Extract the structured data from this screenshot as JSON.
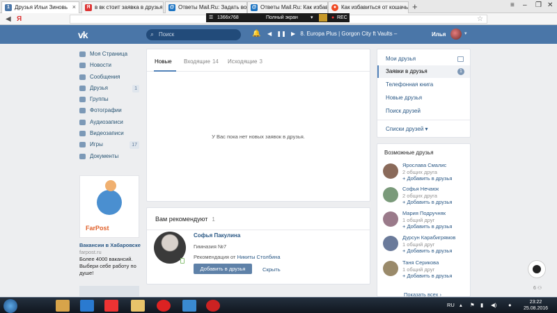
{
  "browser": {
    "tabs": [
      {
        "title": "Друзья Ильи Зиновь",
        "fav": "1",
        "color": "#4a76a8"
      },
      {
        "title": "в вк стоит заявка в друзья",
        "fav": "Я",
        "color": "#d33"
      },
      {
        "title": "Ответы Mail.Ru: Задать воп",
        "fav": "@",
        "color": "#1a73c2"
      },
      {
        "title": "Ответы Mail.Ru: Как избав",
        "fav": "@",
        "color": "#1a73c2"
      },
      {
        "title": "Как избавиться от кошачь",
        "fav": "●",
        "color": "#f04a24"
      }
    ],
    "address_prefix": "Я",
    "capture": {
      "resolution": "1366x768",
      "mode": "Полный экран",
      "rec": "REC"
    }
  },
  "header": {
    "search_placeholder": "Поиск",
    "player": "8. Europa Plus | Gorgon City ft Vaults –",
    "username": "Илья"
  },
  "leftnav": [
    {
      "label": "Моя Страница",
      "count": ""
    },
    {
      "label": "Новости",
      "count": ""
    },
    {
      "label": "Сообщения",
      "count": ""
    },
    {
      "label": "Друзья",
      "count": "1"
    },
    {
      "label": "Группы",
      "count": ""
    },
    {
      "label": "Фотографии",
      "count": ""
    },
    {
      "label": "Аудиозаписи",
      "count": ""
    },
    {
      "label": "Видеозаписи",
      "count": ""
    },
    {
      "label": "Игры",
      "count": "17"
    },
    {
      "label": "Документы",
      "count": ""
    }
  ],
  "ad": {
    "logo": "FarPost",
    "title": "Вакансии в Хабаровске",
    "site": "farpost.ru",
    "text": "Более 4000 вакансий. Выбери себе работу по душе!"
  },
  "requests": {
    "tab_new": "Новые",
    "tab_incoming": "Входящие",
    "tab_incoming_count": "14",
    "tab_outgoing": "Исходящие",
    "tab_outgoing_count": "3",
    "empty": "У Вас пока нет новых заявок в друзья."
  },
  "recommend": {
    "title": "Вам рекомендуют",
    "count": "1",
    "name": "Софья Пакулина",
    "school": "Гимназия №7",
    "from_prefix": "Рекомендация от",
    "from_name": "Никиты Столбина",
    "add_button": "Добавить в друзья",
    "hide": "Скрыть"
  },
  "rightmenu": {
    "items": [
      "Мои друзья",
      "Заявки в друзья",
      "Телефонная книга",
      "Новые друзья",
      "Поиск друзей"
    ],
    "requests_badge": "1",
    "lists": "Списки друзей"
  },
  "possible": {
    "title": "Возможные друзья",
    "add_label": "+ Добавить в друзья",
    "people": [
      {
        "name": "Ярослава Смалис",
        "mutual": "2 общих друга",
        "color": "#8a6a5a"
      },
      {
        "name": "Софья Нечаюк",
        "mutual": "2 общих друга",
        "color": "#7a9a7a"
      },
      {
        "name": "Мария Подручняк",
        "mutual": "1 общий друг",
        "color": "#9a7a8a"
      },
      {
        "name": "Дурсун Карабигрямов",
        "mutual": "1 общий друг",
        "color": "#6a7a9a"
      },
      {
        "name": "Таня Серикова",
        "mutual": "1 общий друг",
        "color": "#9a8a6a"
      }
    ],
    "show_all": "Показать всех"
  },
  "widget_count": "6",
  "taskbar": {
    "lang": "RU",
    "time": "23:22",
    "date": "25.08.2016"
  }
}
